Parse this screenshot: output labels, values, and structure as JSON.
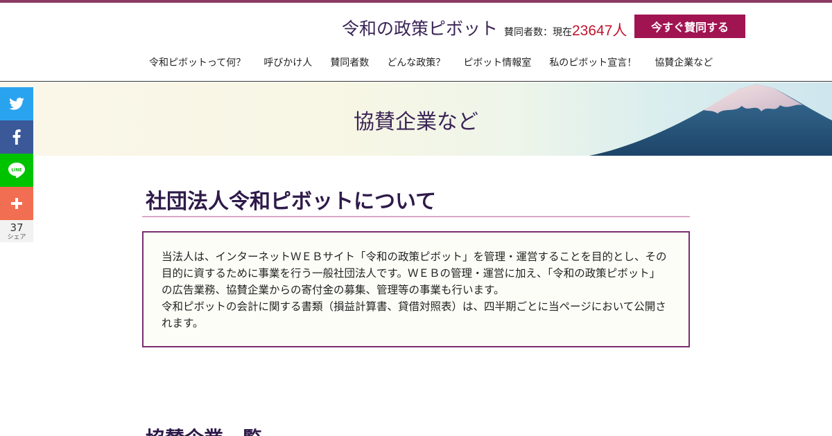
{
  "header": {
    "logo": "令和の政策ピボット",
    "supporters_label": "賛同者数：現在",
    "supporters_count": "23647人",
    "support_button": "今すぐ賛同する"
  },
  "nav": {
    "items": [
      "令和ピボットって何？",
      "呼びかけ人",
      "賛同者数",
      "どんな政策？",
      "ピボット情報室",
      "私のピボット宣言！",
      "協賛企業など"
    ]
  },
  "hero": {
    "title": "協賛企業など"
  },
  "share": {
    "count": "37",
    "unit": "シェア",
    "buttons": [
      "twitter-icon",
      "facebook-icon",
      "line-icon",
      "plus-icon"
    ],
    "line_label": "LINE",
    "colors": {
      "twitter": "#2aa3ef",
      "facebook": "#3b5998",
      "line": "#00c300",
      "more": "#f26e52"
    }
  },
  "main": {
    "section_title": "社団法人令和ピボットについて",
    "paragraph_1": "当法人は、インターネットＷＥＢサイト「令和の政策ピボット」を管理・運営することを目的とし、その目的に資するために事業を行う一般社団法人です。ＷＥＢの管理・運営に加え、「令和の政策ピボット」の広告業務、協賛企業からの寄付金の募集、管理等の事業も行います。",
    "paragraph_2": "令和ピボットの会計に関する書類（損益計算書、貸借対照表）は、四半期ごとに当ページにおいて公開されます。",
    "section_title_2": "協賛企業一覧"
  },
  "colors": {
    "accent": "#a11452",
    "title": "#3a2456",
    "count": "#c0152f"
  }
}
